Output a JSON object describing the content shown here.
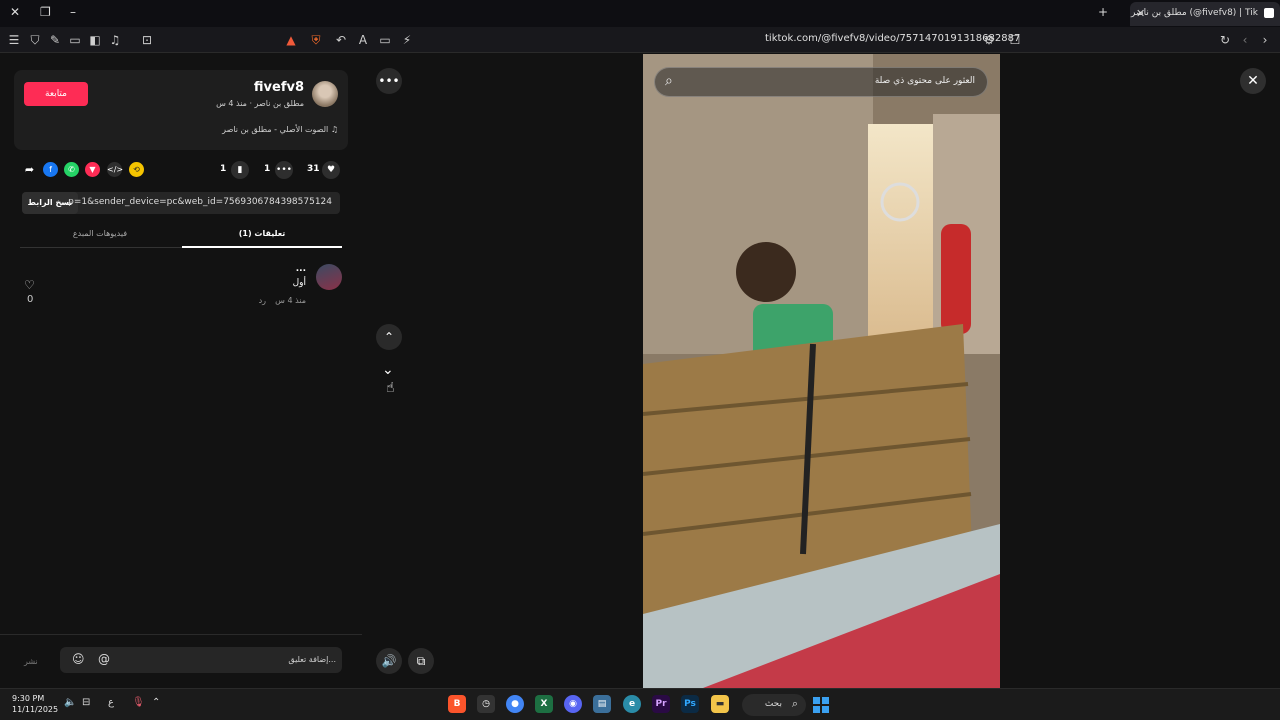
{
  "browser": {
    "tab_title": "مطلق بن ناصر (@fivefv8) | Tik",
    "url": "tiktok.com/@fivefv8/video/7571470191318682887",
    "new_tab_label": "+"
  },
  "video_panel": {
    "author": {
      "username": "fivefv8",
      "subtitle": "مطلق بن ناصر · منذ 4 س",
      "follow_label": "متابعة",
      "music": "الصوت الأصلي - مطلق بن ناصر"
    },
    "stats": {
      "likes": "31",
      "comments": "1",
      "saves": "1"
    },
    "link": {
      "text": "...p=1&sender_device=pc&web_id=7569306784398575124",
      "copy_label": "نسخ الرابط"
    },
    "tabs": [
      {
        "label": "(1) تعليقات",
        "active": true
      },
      {
        "label": "فيديوهات المبدع",
        "active": false
      }
    ],
    "comments": [
      {
        "name": "...",
        "text": "أول",
        "meta": "منذ 4 س",
        "reply": "رد",
        "likes": "0"
      }
    ],
    "composer": {
      "placeholder": "إضافة تعليق...",
      "post_label": "نشر"
    }
  },
  "player": {
    "search_placeholder": "العثور على محتوى ذي صلة"
  },
  "taskbar": {
    "time": "9:30 PM",
    "date": "11/11/2025",
    "search_label": "بحث",
    "lang": "ع"
  },
  "colors": {
    "follow": "#fe2c55",
    "background": "#121212"
  }
}
